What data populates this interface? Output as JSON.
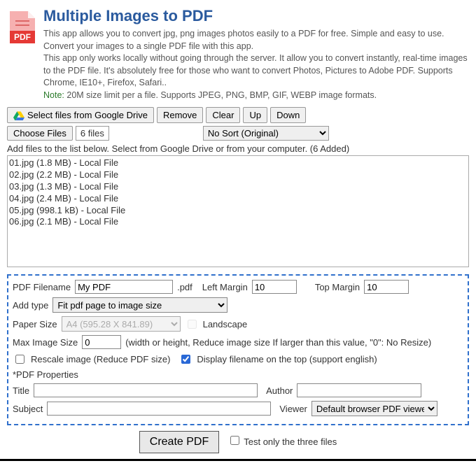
{
  "header": {
    "title": "Multiple Images to PDF",
    "desc1": "This app allows you to convert jpg, png images photos easily to a PDF for free. Simple and easy to use. Convert your images to a single PDF file with this app.",
    "desc2": "This app only works locally without going through the server. It allow you to convert instantly, real-time images to the PDF file. It's absolutely free for those who want to convert Photos, Pictures to Adobe PDF. Supports Chrome, IE10+, Firefox, Safari..",
    "noteLabel": "Note:",
    "noteText": " 20M size limit per a file. Supports JPEG, PNG, BMP, GIF, WEBP image formats."
  },
  "toolbar": {
    "gdrive": "Select files from Google Drive",
    "remove": "Remove",
    "clear": "Clear",
    "up": "Up",
    "down": "Down"
  },
  "fileRow": {
    "choose": "Choose Files",
    "count": "6 files",
    "sort": "No Sort (Original)"
  },
  "addHint": "Add files to the list below. Select from Google Drive or from your computer. (6 Added)",
  "files": [
    "01.jpg (1.8 MB) - Local File",
    "02.jpg (2.2 MB) - Local File",
    "03.jpg (1.3 MB) - Local File",
    "04.jpg (2.4 MB) - Local File",
    "05.jpg (998.1 kB) - Local File",
    "06.jpg (2.1 MB) - Local File"
  ],
  "settings": {
    "filenameLabel": "PDF Filename",
    "filenameValue": "My PDF",
    "ext": ".pdf",
    "leftMarginLabel": "Left Margin",
    "leftMarginValue": "10",
    "topMarginLabel": "Top Margin",
    "topMarginValue": "10",
    "addTypeLabel": "Add type",
    "addTypeValue": "Fit pdf page to image size",
    "paperSizeLabel": "Paper Size",
    "paperSizeValue": "A4 (595.28 X 841.89)",
    "landscapeLabel": "Landscape",
    "maxImgLabel": "Max Image Size",
    "maxImgValue": "0",
    "maxImgHint": "(width or height, Reduce image size If larger than this value, \"0\": No Resize)",
    "rescaleLabel": "Rescale image (Reduce PDF size)",
    "displayFnLabel": "Display filename on the top (support english)",
    "pdfPropsLabel": "*PDF Properties",
    "titleLabel": "Title",
    "authorLabel": "Author",
    "subjectLabel": "Subject",
    "viewerLabel": "Viewer",
    "viewerValue": "Default browser PDF viewer"
  },
  "create": {
    "button": "Create PDF",
    "testLabel": "Test only the three files"
  }
}
